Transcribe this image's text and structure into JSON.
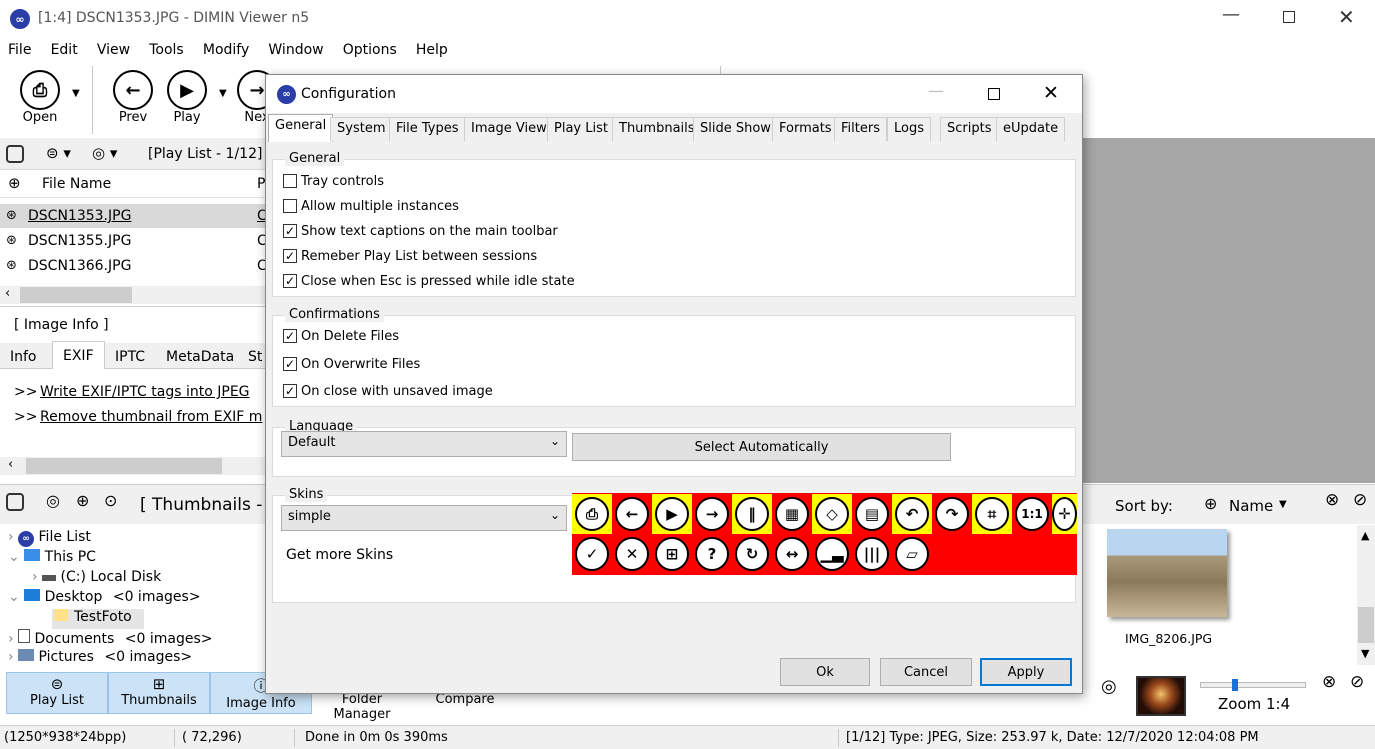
{
  "window": {
    "title": "[1:4] DSCN1353.JPG - DIMIN Viewer n5"
  },
  "menu": [
    "File",
    "Edit",
    "View",
    "Tools",
    "Modify",
    "Window",
    "Options",
    "Help"
  ],
  "toolbar": {
    "open": "Open",
    "prev": "Prev",
    "play": "Play",
    "next": "Nex"
  },
  "playlist": {
    "header": "[Play List - 1/12]",
    "column": "File Name",
    "column2": "P",
    "files": [
      "DSCN1353.JPG",
      "DSCN1355.JPG",
      "DSCN1366.JPG"
    ],
    "file_c": "C"
  },
  "imageinfo": {
    "header": "[ Image Info ]",
    "tabs": [
      "Info",
      "EXIF",
      "IPTC",
      "MetaData",
      "St"
    ],
    "links": [
      "Write EXIF/IPTC tags into JPEG",
      "Remove thumbnail from EXIF m"
    ],
    "link_prefix": ">>"
  },
  "thumbnails": {
    "header": "[ Thumbnails -",
    "sort_label": "Sort by:",
    "sort_value": "Name",
    "image_name": "IMG_8206.JPG"
  },
  "tree": [
    {
      "label": "File List",
      "extra": ""
    },
    {
      "label": "This PC",
      "extra": ""
    },
    {
      "label": "(C:)  Local Disk",
      "extra": ""
    },
    {
      "label": "Desktop",
      "extra": "<0 images>"
    },
    {
      "label": "TestFoto",
      "extra": ""
    },
    {
      "label": "Documents",
      "extra": "<0 images>"
    },
    {
      "label": "Pictures",
      "extra": "<0 images>"
    }
  ],
  "dialog": {
    "title": "Configuration",
    "tabs": [
      "General",
      "System",
      "File Types",
      "Image View",
      "Play List",
      "Thumbnails",
      "Slide Show",
      "Formats",
      "Filters",
      "Logs",
      "Scripts",
      "eUpdate"
    ],
    "general_group": "General",
    "general_opts": [
      {
        "label": "Tray controls",
        "checked": false
      },
      {
        "label": "Allow multiple instances",
        "checked": false
      },
      {
        "label": "Show text captions on the main toolbar",
        "checked": true
      },
      {
        "label": "Remeber Play List between sessions",
        "checked": true
      },
      {
        "label": "Close when Esc is pressed while idle state",
        "checked": true
      }
    ],
    "confirm_group": "Confirmations",
    "confirm_opts": [
      {
        "label": "On Delete Files",
        "checked": true
      },
      {
        "label": "On Overwrite Files",
        "checked": true
      },
      {
        "label": "On close with unsaved image",
        "checked": true
      }
    ],
    "language_group": "Language",
    "language_value": "Default",
    "select_auto": "Select Automatically",
    "skins_group": "Skins",
    "skin_value": "simple",
    "get_more": "Get more Skins",
    "skin_icons_row1": [
      "open-icon",
      "prev-icon",
      "play-icon",
      "next-icon",
      "pause-icon",
      "grid-icon",
      "single-icon",
      "thumbs-icon",
      "rotate-left-icon",
      "rotate-right-icon",
      "fit-icon",
      "actual-size-icon",
      "expand-icon"
    ],
    "skin_icons_row2": [
      "ok-icon",
      "cancel-icon",
      "apps-icon",
      "help-icon",
      "refresh-icon",
      "resize-icon",
      "histogram-icon",
      "barcode-icon",
      "eraser-icon"
    ],
    "actual_size_text": "1:1",
    "ok": "Ok",
    "cancel": "Cancel",
    "apply": "Apply",
    "colors": {
      "skin_bg": "#ff0000",
      "skin_highlight": "#ffff00"
    }
  },
  "bottom": {
    "buttons": [
      "Play List",
      "Thumbnails",
      "Image Info",
      "Folder Manager",
      "Compare"
    ],
    "zoom": "Zoom 1:4",
    "zoom_fraction": 0.3
  },
  "status": {
    "dims": "(1250*938*24bpp)",
    "coords": "( 72,296)",
    "done": "Done in 0m 0s 390ms",
    "info": "[1/12] Type: JPEG, Size: 253.97 k, Date: 12/7/2020 12:04:08 PM"
  }
}
